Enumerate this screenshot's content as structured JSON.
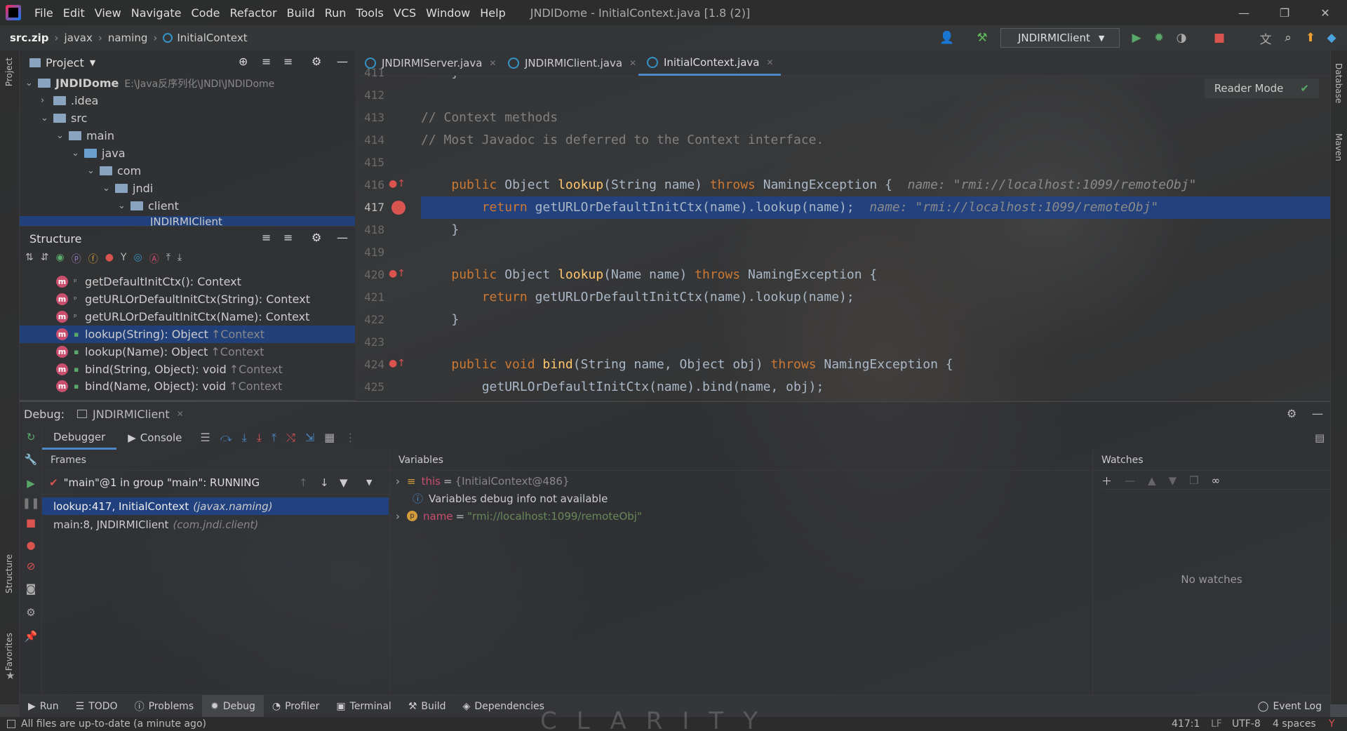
{
  "menubar": {
    "items": [
      "File",
      "Edit",
      "View",
      "Navigate",
      "Code",
      "Refactor",
      "Build",
      "Run",
      "Tools",
      "VCS",
      "Window",
      "Help"
    ],
    "title": "JNDIDome - InitialContext.java [1.8 (2)]"
  },
  "navbar": {
    "crumbs": [
      "src.zip",
      "javax",
      "naming",
      "InitialContext"
    ],
    "run_config": "JNDIRMIClient"
  },
  "project": {
    "title": "Project",
    "rows": [
      {
        "label": "JNDIDome",
        "extra": "E:\\Java反序列化\\JNDI\\JNDIDome"
      },
      {
        "label": ".idea"
      },
      {
        "label": "src"
      },
      {
        "label": "main"
      },
      {
        "label": "java"
      },
      {
        "label": "com"
      },
      {
        "label": "jndi"
      },
      {
        "label": "client"
      },
      {
        "label": "JNDIRMIClient"
      }
    ]
  },
  "structure": {
    "title": "Structure",
    "rows": [
      {
        "label": "getDefaultInitCtx(): Context",
        "extra": ""
      },
      {
        "label": "getURLOrDefaultInitCtx(String): Context",
        "extra": ""
      },
      {
        "label": "getURLOrDefaultInitCtx(Name): Context",
        "extra": ""
      },
      {
        "label": "lookup(String): Object",
        "extra": "↑Context"
      },
      {
        "label": "lookup(Name): Object",
        "extra": "↑Context"
      },
      {
        "label": "bind(String, Object): void",
        "extra": "↑Context"
      },
      {
        "label": "bind(Name, Object): void",
        "extra": "↑Context"
      }
    ]
  },
  "editor": {
    "tabs": [
      "JNDIRMIServer.java",
      "JNDIRMIClient.java",
      "InitialContext.java"
    ],
    "reader_mode": "Reader Mode",
    "line_numbers": [
      "411",
      "412",
      "413",
      "414",
      "415",
      "416",
      "417",
      "418",
      "419",
      "420",
      "421",
      "422",
      "423",
      "424",
      "425"
    ],
    "line416_hint": "name: \"rmi://localhost:1099/remoteObj\"",
    "line417_hint": "name: \"rmi://localhost:1099/remoteObj\"",
    "comment1": "// Context methods",
    "comment2": "// Most Javadoc is deferred to the Context interface."
  },
  "debug": {
    "label": "Debug:",
    "session": "JNDIRMIClient",
    "tabs": [
      "Debugger",
      "Console"
    ],
    "frames_title": "Frames",
    "thread": "\"main\"@1 in group \"main\": RUNNING",
    "frames": [
      {
        "label": "lookup:417, InitialContext",
        "pkg": "(javax.naming)"
      },
      {
        "label": "main:8, JNDIRMIClient",
        "pkg": "(com.jndi.client)"
      }
    ],
    "variables_title": "Variables",
    "vars": [
      {
        "name": "this",
        "value": "{InitialContext@486}"
      },
      {
        "name": "Variables debug info not available",
        "value": ""
      },
      {
        "name": "name",
        "value": "\"rmi://localhost:1099/remoteObj\""
      }
    ],
    "watches_title": "Watches",
    "no_watches": "No watches"
  },
  "bottom": {
    "items": [
      "Run",
      "TODO",
      "Problems",
      "Debug",
      "Profiler",
      "Terminal",
      "Build",
      "Dependencies"
    ],
    "event_log": "Event Log"
  },
  "status": {
    "message": "All files are up-to-date (a minute ago)",
    "pos": "417:1",
    "lf": "LF",
    "enc": "UTF-8",
    "indent": "4 spaces",
    "watermark": "CLARITY"
  },
  "strips": {
    "project": "Project",
    "structure": "Structure",
    "favorites": "Favorites",
    "database": "Database",
    "maven": "Maven"
  }
}
